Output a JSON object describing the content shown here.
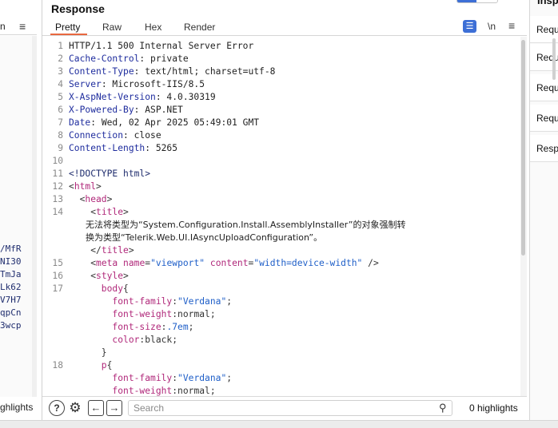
{
  "left_pane": {
    "tab_fragment": "n",
    "lines": [
      "/MfR",
      "NI30",
      "TmJa",
      "Lk62",
      "V7H7",
      "qpCn",
      "3wcp"
    ],
    "highlights_fragment": "ghlights"
  },
  "response": {
    "title": "Response",
    "tabs": [
      "Pretty",
      "Raw",
      "Hex",
      "Render"
    ],
    "active_tab": "Pretty",
    "newline_label": "\\n",
    "wrap_icon": "wrap-lines-icon",
    "menu_icon": "hamburger-icon",
    "lines": [
      {
        "n": "1",
        "parts": [
          {
            "t": "HTTP/1.1 500 Internal Server Error",
            "c": "hv"
          }
        ]
      },
      {
        "n": "2",
        "parts": [
          {
            "t": "Cache-Control",
            "c": "hk"
          },
          {
            "t": ": private",
            "c": "hv"
          }
        ]
      },
      {
        "n": "3",
        "parts": [
          {
            "t": "Content-Type",
            "c": "hk"
          },
          {
            "t": ": text/html; charset=utf-8",
            "c": "hv"
          }
        ]
      },
      {
        "n": "4",
        "parts": [
          {
            "t": "Server",
            "c": "hk"
          },
          {
            "t": ": Microsoft-IIS/8.5",
            "c": "hv"
          }
        ]
      },
      {
        "n": "5",
        "parts": [
          {
            "t": "X-AspNet-Version",
            "c": "hk"
          },
          {
            "t": ": 4.0.30319",
            "c": "hv"
          }
        ]
      },
      {
        "n": "6",
        "parts": [
          {
            "t": "X-Powered-By",
            "c": "hk"
          },
          {
            "t": ": ASP.NET",
            "c": "hv"
          }
        ]
      },
      {
        "n": "7",
        "parts": [
          {
            "t": "Date",
            "c": "hk"
          },
          {
            "t": ": Wed, 02 Apr 2025 05:49:01 GMT",
            "c": "hv"
          }
        ]
      },
      {
        "n": "8",
        "parts": [
          {
            "t": "Connection",
            "c": "hk"
          },
          {
            "t": ": close",
            "c": "hv"
          }
        ]
      },
      {
        "n": "9",
        "parts": [
          {
            "t": "Content-Length",
            "c": "hk"
          },
          {
            "t": ": 5265",
            "c": "hv"
          }
        ]
      },
      {
        "n": "10",
        "parts": []
      },
      {
        "n": "11",
        "parts": [
          {
            "t": "<!DOCTYPE html>",
            "c": "doctype"
          }
        ]
      },
      {
        "n": "12",
        "parts": [
          {
            "t": "<",
            "c": "punct"
          },
          {
            "t": "html",
            "c": "tag"
          },
          {
            "t": ">",
            "c": "punct"
          }
        ]
      },
      {
        "n": "13",
        "parts": [
          {
            "t": "  <",
            "c": "punct"
          },
          {
            "t": "head",
            "c": "tag"
          },
          {
            "t": ">",
            "c": "punct"
          }
        ]
      },
      {
        "n": "14",
        "parts": [
          {
            "t": "    <",
            "c": "punct"
          },
          {
            "t": "title",
            "c": "tag"
          },
          {
            "t": ">",
            "c": "punct"
          }
        ]
      },
      {
        "n": "",
        "parts": [
          {
            "t": "      无法将类型为“System.Configuration.Install.AssemblyInstaller”的对象强制转",
            "c": "txt cjk"
          }
        ]
      },
      {
        "n": "",
        "parts": [
          {
            "t": "      换为类型“Telerik.Web.UI.IAsyncUploadConfiguration”。",
            "c": "txt cjk"
          }
        ]
      },
      {
        "n": "",
        "parts": [
          {
            "t": "    </",
            "c": "punct"
          },
          {
            "t": "title",
            "c": "tag"
          },
          {
            "t": ">",
            "c": "punct"
          }
        ]
      },
      {
        "n": "15",
        "parts": [
          {
            "t": "    <",
            "c": "punct"
          },
          {
            "t": "meta",
            "c": "tag"
          },
          {
            "t": " ",
            "c": "punct"
          },
          {
            "t": "name",
            "c": "attr"
          },
          {
            "t": "=",
            "c": "punct"
          },
          {
            "t": "\"viewport\"",
            "c": "str"
          },
          {
            "t": " ",
            "c": "punct"
          },
          {
            "t": "content",
            "c": "attr"
          },
          {
            "t": "=",
            "c": "punct"
          },
          {
            "t": "\"width=device-width\"",
            "c": "str"
          },
          {
            "t": " />",
            "c": "punct"
          }
        ]
      },
      {
        "n": "16",
        "parts": [
          {
            "t": "    <",
            "c": "punct"
          },
          {
            "t": "style",
            "c": "tag"
          },
          {
            "t": ">",
            "c": "punct"
          }
        ]
      },
      {
        "n": "17",
        "parts": [
          {
            "t": "      body",
            "c": "prop"
          },
          {
            "t": "{",
            "c": "punct"
          }
        ]
      },
      {
        "n": "",
        "parts": [
          {
            "t": "        font-family",
            "c": "prop"
          },
          {
            "t": ":",
            "c": "punct"
          },
          {
            "t": "\"Verdana\"",
            "c": "str"
          },
          {
            "t": ";",
            "c": "punct"
          }
        ]
      },
      {
        "n": "",
        "parts": [
          {
            "t": "        font-weight",
            "c": "prop"
          },
          {
            "t": ":normal;",
            "c": "punct"
          }
        ]
      },
      {
        "n": "",
        "parts": [
          {
            "t": "        font-size",
            "c": "prop"
          },
          {
            "t": ":",
            "c": "punct"
          },
          {
            "t": ".7em",
            "c": "str"
          },
          {
            "t": ";",
            "c": "punct"
          }
        ]
      },
      {
        "n": "",
        "parts": [
          {
            "t": "        color",
            "c": "prop"
          },
          {
            "t": ":black;",
            "c": "punct"
          }
        ]
      },
      {
        "n": "",
        "parts": [
          {
            "t": "      }",
            "c": "punct"
          }
        ]
      },
      {
        "n": "18",
        "parts": [
          {
            "t": "      p",
            "c": "prop"
          },
          {
            "t": "{",
            "c": "punct"
          }
        ]
      },
      {
        "n": "",
        "parts": [
          {
            "t": "        font-family",
            "c": "prop"
          },
          {
            "t": ":",
            "c": "punct"
          },
          {
            "t": "\"Verdana\"",
            "c": "str"
          },
          {
            "t": ";",
            "c": "punct"
          }
        ]
      },
      {
        "n": "",
        "parts": [
          {
            "t": "        font-weight",
            "c": "prop"
          },
          {
            "t": ":normal;",
            "c": "punct"
          }
        ]
      }
    ],
    "bottom": {
      "search_placeholder": "Search",
      "highlights_label": "0 highlights"
    }
  },
  "inspector": {
    "title": "Insp",
    "items": [
      "Requ",
      "Requ",
      "Requ",
      "Requ",
      "Resp"
    ]
  },
  "colors": {
    "accent_blue": "#3d6fd6",
    "active_tab_underline": "#e8683f",
    "header_key": "#1f2d9e",
    "tag": "#b0287a",
    "string": "#1f5fc8"
  }
}
